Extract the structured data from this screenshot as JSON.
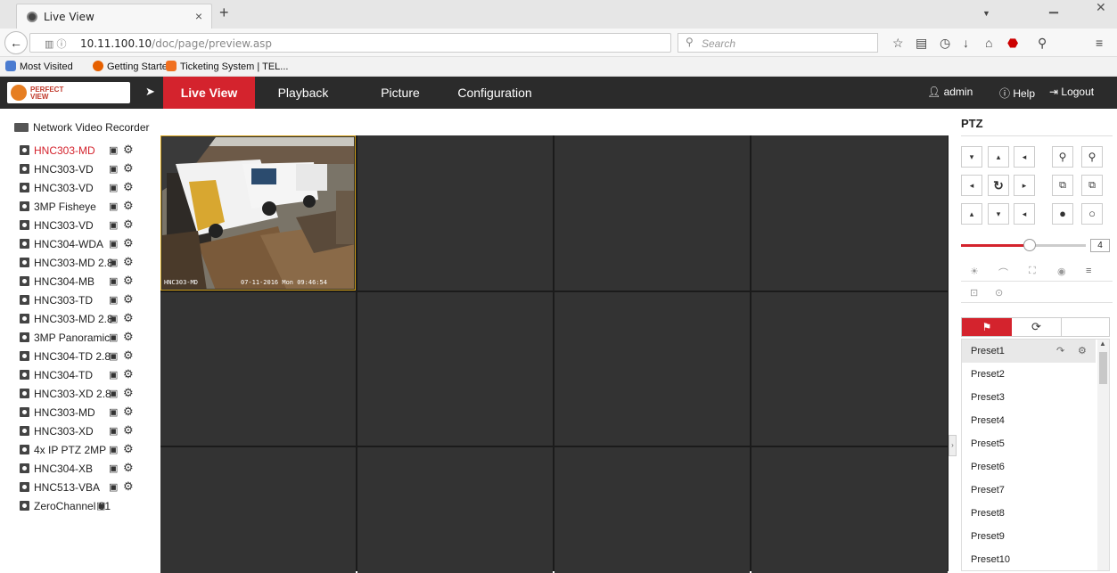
{
  "browser": {
    "tab_title": "Live View",
    "tab_close": "×",
    "new_tab": "+",
    "url_prefix": "10.11.100.10",
    "url_path": "/doc/page/preview.asp",
    "search_placeholder": "Search",
    "bookmarks": [
      "Most Visited",
      "Getting Started",
      "Ticketing System | TEL..."
    ]
  },
  "app": {
    "logo_text": "PERFECT VIEW",
    "menu": [
      "Live View",
      "Playback",
      "Picture",
      "Configuration"
    ],
    "active_menu": "Live View",
    "user": "admin",
    "help": "Help",
    "logout": "Logout"
  },
  "device_tree": {
    "root": "Network Video Recorder",
    "cameras": [
      "HNC303-MD",
      "HNC303-VD",
      "HNC303-VD",
      "3MP Fisheye",
      "HNC303-VD",
      "HNC304-WDA",
      "HNC303-MD 2.8",
      "HNC304-MB",
      "HNC303-TD",
      "HNC303-MD 2.8",
      "3MP Panoramic",
      "HNC304-TD 2.8",
      "HNC304-TD",
      "HNC303-XD 2.8",
      "HNC303-MD",
      "HNC303-XD",
      "4x IP PTZ 2MP",
      "HNC304-XB",
      "HNC513-VBA",
      "ZeroChannel 01"
    ],
    "active_camera": "HNC303-MD"
  },
  "live_view": {
    "osd_camera": "HNC303-MD",
    "osd_time": "07-11-2016 Mon 09:46:54"
  },
  "ptz": {
    "title": "PTZ",
    "speed": "4",
    "speed_level": 0.55,
    "presets": [
      "Preset1",
      "Preset2",
      "Preset3",
      "Preset4",
      "Preset5",
      "Preset6",
      "Preset7",
      "Preset8",
      "Preset9",
      "Preset10"
    ],
    "highlighted_preset": "Preset1"
  },
  "colors": {
    "accent": "#d4232d",
    "appbar": "#2b2b2b",
    "grid_bg": "#333333"
  }
}
